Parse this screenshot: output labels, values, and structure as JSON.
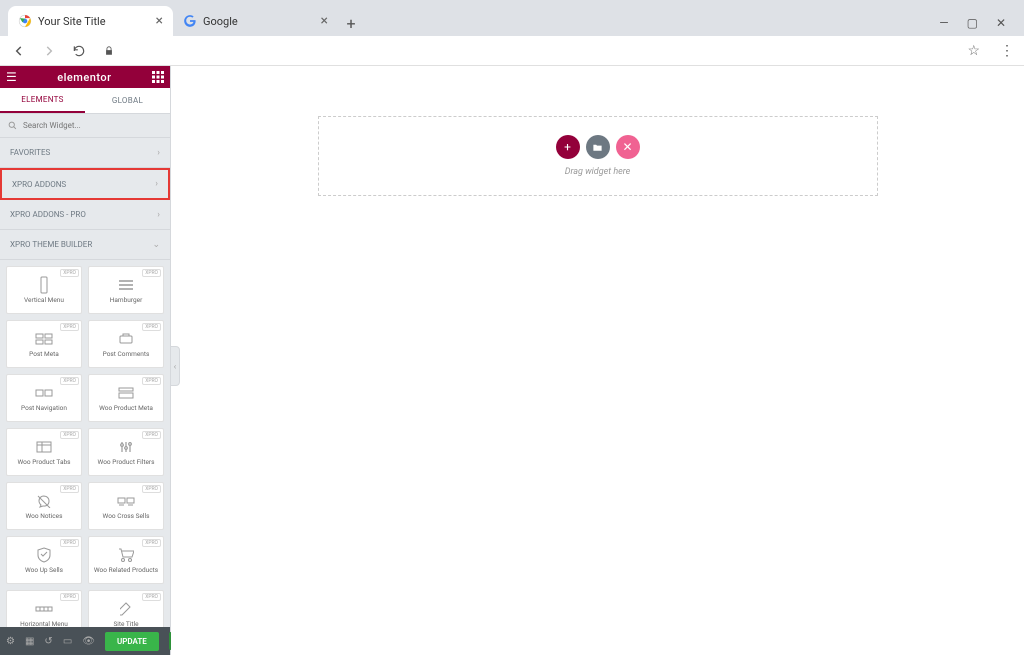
{
  "browser": {
    "tabs": [
      {
        "title": "Your Site Title",
        "favicon": "chrome"
      },
      {
        "title": "Google",
        "favicon": "google"
      }
    ],
    "window_controls": {
      "min": "—",
      "max": "▢",
      "close": "✕"
    }
  },
  "elementor": {
    "brand": "elementor",
    "panel_tabs": {
      "elements": "ELEMENTS",
      "global": "GLOBAL"
    },
    "search_placeholder": "Search Widget...",
    "categories": [
      {
        "label": "FAVORITES",
        "expanded": false,
        "highlight": false
      },
      {
        "label": "XPRO ADDONS",
        "expanded": false,
        "highlight": true
      },
      {
        "label": "XPRO ADDONS - PRO",
        "expanded": false,
        "highlight": false
      },
      {
        "label": "XPRO THEME BUILDER",
        "expanded": true,
        "highlight": false
      }
    ],
    "widget_badge": "XPRO",
    "widgets": [
      {
        "label": "Vertical Menu"
      },
      {
        "label": "Hamburger"
      },
      {
        "label": "Post Meta"
      },
      {
        "label": "Post Comments"
      },
      {
        "label": "Post Navigation"
      },
      {
        "label": "Woo Product Meta"
      },
      {
        "label": "Woo Product Tabs"
      },
      {
        "label": "Woo Product Filters"
      },
      {
        "label": "Woo Notices"
      },
      {
        "label": "Woo Cross Sells"
      },
      {
        "label": "Woo Up Sells"
      },
      {
        "label": "Woo Related Products"
      },
      {
        "label": "Horizontal Menu"
      },
      {
        "label": "Site Title"
      }
    ],
    "update_label": "UPDATE"
  },
  "canvas": {
    "drop_text": "Drag widget here"
  }
}
